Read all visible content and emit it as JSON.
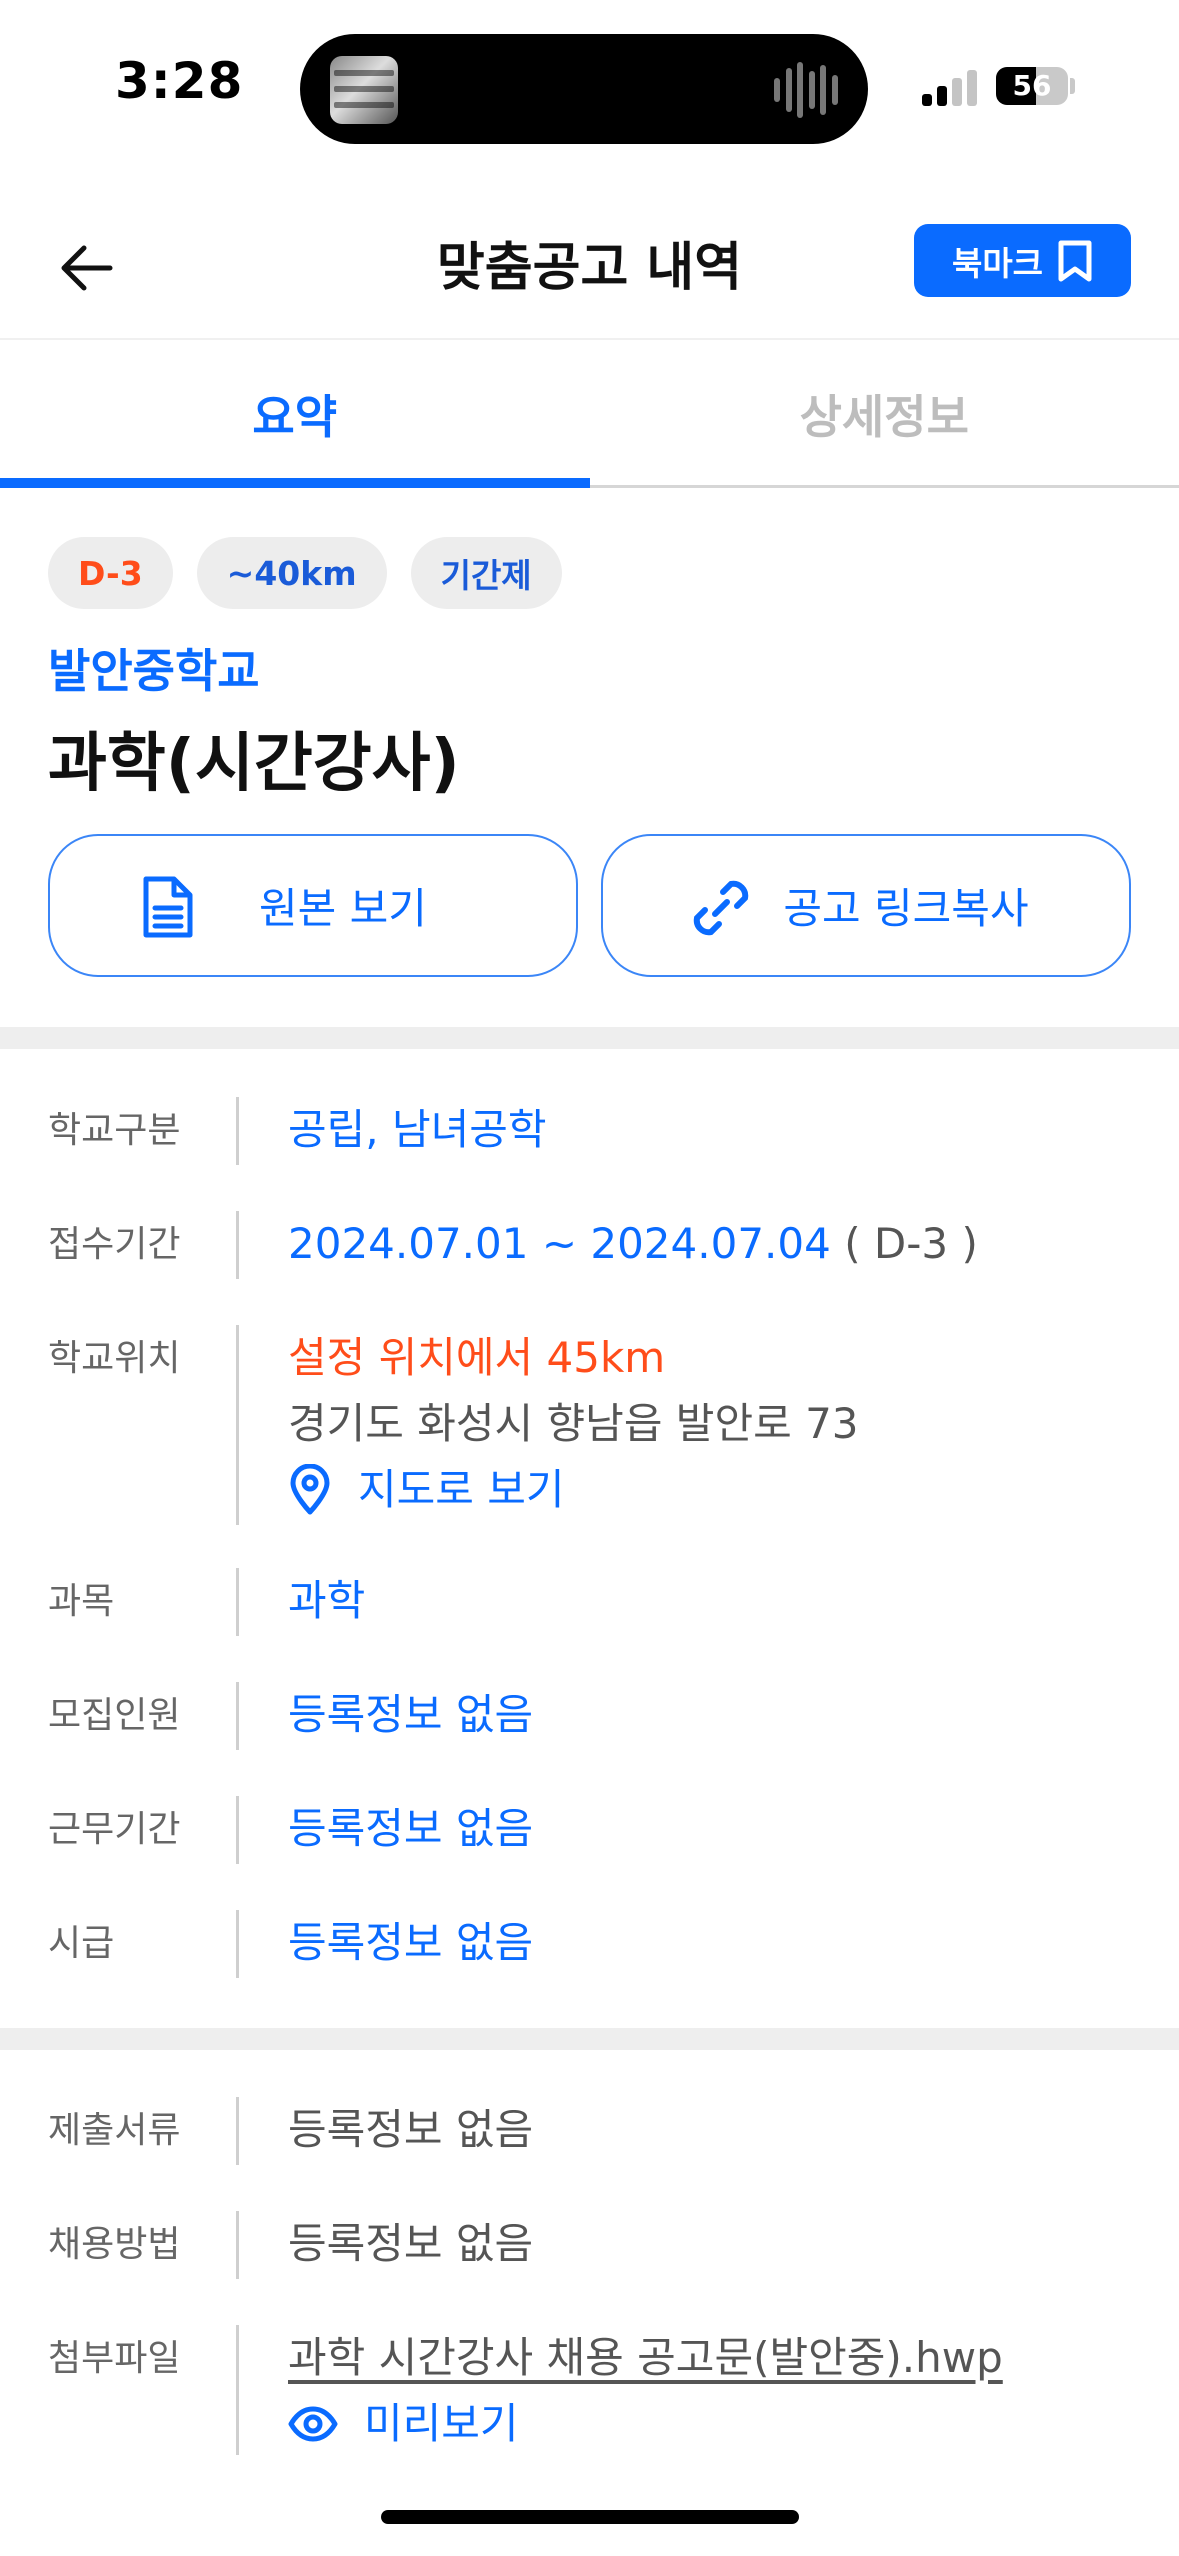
{
  "status_bar": {
    "time": "3:28",
    "battery": "56",
    "battery_level": 0.56
  },
  "header": {
    "title": "맞춤공고 내역",
    "bookmark_label": "북마크"
  },
  "tabs": [
    {
      "label": "요약",
      "active": true
    },
    {
      "label": "상세정보",
      "active": false
    }
  ],
  "summary": {
    "chips": [
      "D-3",
      "~40km",
      "기간제"
    ],
    "school": "발안중학교",
    "title": "과학(시간강사)",
    "view_original_label": "원본 보기",
    "copy_link_label": "공고 링크복사"
  },
  "info": {
    "school_type": {
      "label": "학교구분",
      "value": "공립, 남녀공학"
    },
    "period": {
      "label": "접수기간",
      "value": "2024.07.01 ~ 2024.07.04",
      "dday": " ( D-3 )"
    },
    "location": {
      "label": "학교위치",
      "distance": "설정 위치에서 45km",
      "address": "경기도 화성시 향남읍 발안로 73",
      "map_label": "지도로 보기"
    },
    "subject": {
      "label": "과목",
      "value": "과학"
    },
    "recruits": {
      "label": "모집인원",
      "value": "등록정보 없음"
    },
    "work_period": {
      "label": "근무기간",
      "value": "등록정보 없음"
    },
    "hourly_pay": {
      "label": "시급",
      "value": "등록정보 없음"
    }
  },
  "extra": {
    "documents": {
      "label": "제출서류",
      "value": "등록정보 없음"
    },
    "method": {
      "label": "채용방법",
      "value": "등록정보 없음"
    },
    "attachment": {
      "label": "첨부파일",
      "file": "과학 시간강사 채용 공고문(발안중).hwp",
      "preview_label": "미리보기"
    }
  },
  "colors": {
    "accent": "#0a6bff",
    "danger": "#ff4d1a",
    "chip_bg": "#ededed"
  }
}
